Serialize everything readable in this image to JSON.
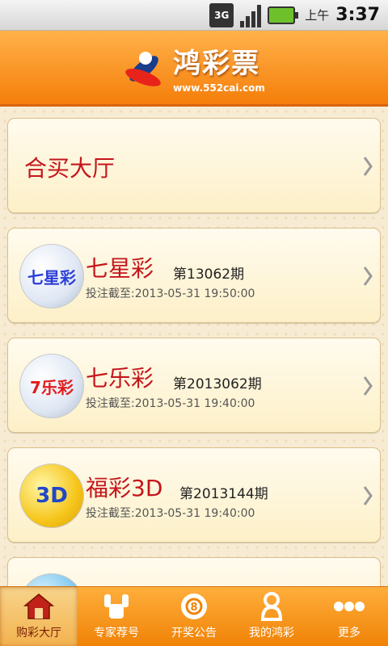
{
  "status_bar": {
    "network": "3G",
    "ampm": "上午",
    "time": "3:37"
  },
  "header": {
    "app_name": "鸿彩票",
    "url": "www.552cai.com"
  },
  "hall_card": {
    "label": "合买大厅"
  },
  "lotteries": [
    {
      "icon": "qixingcai-logo-icon",
      "icon_text": "七星彩",
      "name": "七星彩",
      "issue": "第13062期",
      "deadline": "投注截至:2013-05-31 19:50:00"
    },
    {
      "icon": "qilecai-logo-icon",
      "icon_text": "7乐彩",
      "name": "七乐彩",
      "issue": "第2013062期",
      "deadline": "投注截至:2013-05-31 19:40:00"
    },
    {
      "icon": "fucai3d-logo-icon",
      "icon_text": "3D",
      "name": "福彩3D",
      "issue": "第2013144期",
      "deadline": "投注截至:2013-05-31 19:40:00"
    }
  ],
  "bottom_nav": [
    {
      "label": "购彩大厅",
      "icon": "home-icon",
      "active": true
    },
    {
      "label": "专家荐号",
      "icon": "expert-icon",
      "active": false
    },
    {
      "label": "开奖公告",
      "icon": "ball-8-icon",
      "active": false
    },
    {
      "label": "我的鸿彩",
      "icon": "user-icon",
      "active": false
    },
    {
      "label": "更多",
      "icon": "more-dots-icon",
      "active": false
    }
  ],
  "colors": {
    "header_orange": "#f57e0a",
    "title_red": "#c4161c",
    "card_bg": "#fdf0c8"
  }
}
